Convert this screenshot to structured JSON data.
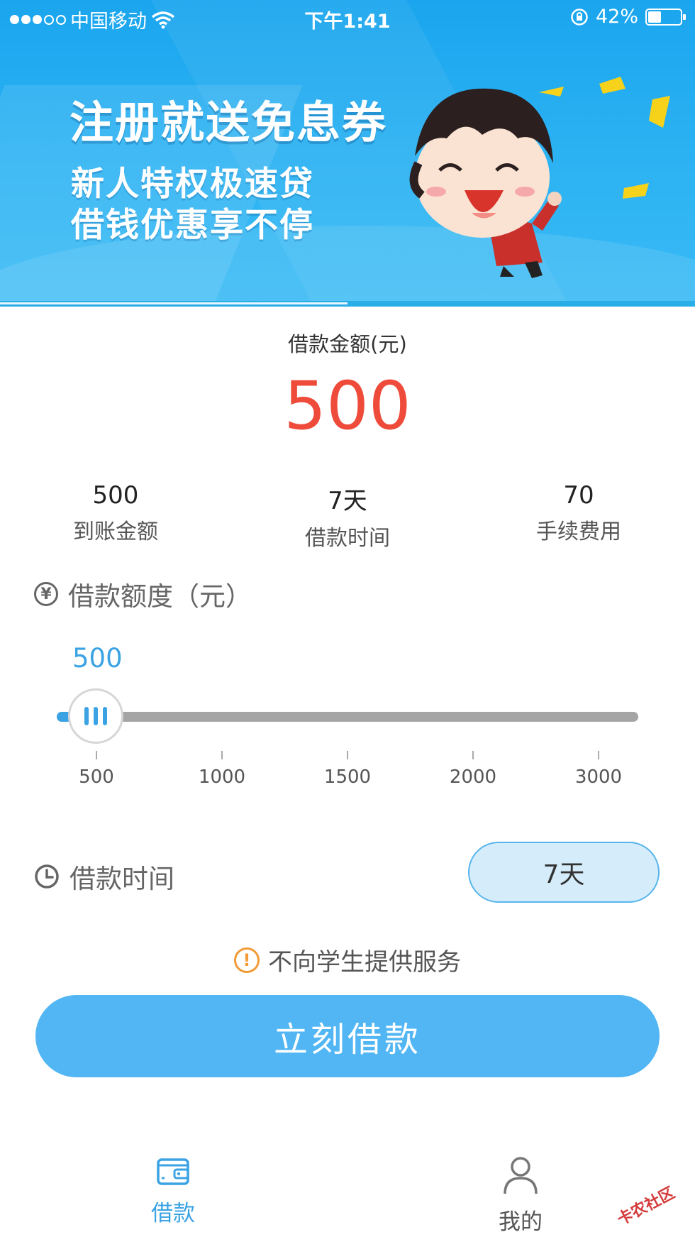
{
  "status_bar": {
    "carrier": "中国移动",
    "time": "下午1:41",
    "battery": "42%",
    "battery_level": 0.42
  },
  "banner": {
    "title": "注册就送免息券",
    "line1": "新人特权极速贷",
    "line2": "借钱优惠享不停"
  },
  "loan": {
    "amount_label": "借款金额(元)",
    "amount_value": "500",
    "stats": [
      {
        "value": "500",
        "label": "到账金额"
      },
      {
        "value": "7天",
        "label": "借款时间"
      },
      {
        "value": "70",
        "label": "手续费用"
      }
    ]
  },
  "limit": {
    "title": "借款额度（元）",
    "icon": "yen-circle-icon",
    "icon_glyph": "¥",
    "slider_value": "500",
    "slider_fraction": 0,
    "ticks": [
      "500",
      "1000",
      "1500",
      "2000",
      "3000"
    ]
  },
  "term": {
    "title": "借款时间",
    "icon": "clock-icon",
    "selected": "7天"
  },
  "notice": {
    "icon": "warning-icon",
    "icon_glyph": "!",
    "text": "不向学生提供服务"
  },
  "cta": {
    "label": "立刻借款"
  },
  "tabs": [
    {
      "label": "借款",
      "icon": "wallet-icon",
      "active": true
    },
    {
      "label": "我的",
      "icon": "user-icon",
      "active": false
    }
  ],
  "colors": {
    "accent": "#3ba3e3",
    "amount": "#ef4b3a",
    "button": "#51b6f3",
    "warning": "#f19a36"
  }
}
